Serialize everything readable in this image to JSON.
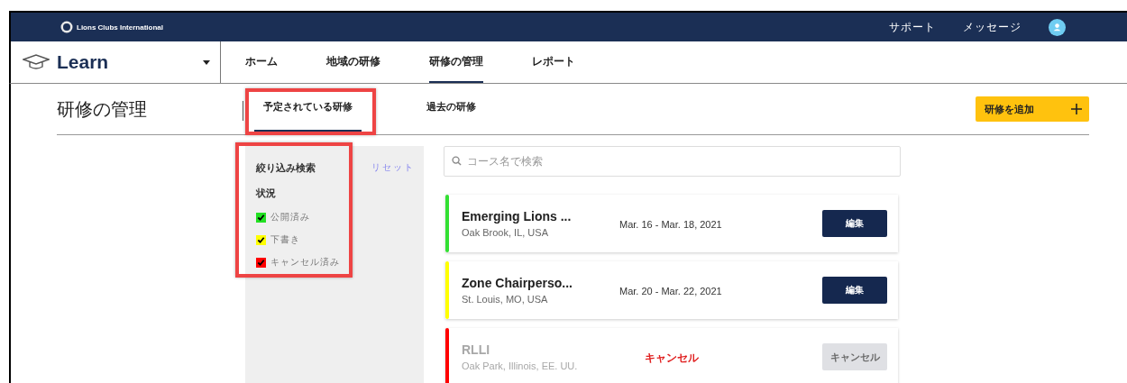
{
  "header": {
    "brand": "Lions Clubs International",
    "links": [
      "サポート",
      "メッセージ"
    ]
  },
  "app": {
    "name": "Learn"
  },
  "nav": [
    {
      "label": "ホーム",
      "selected": false
    },
    {
      "label": "地域の研修",
      "selected": false
    },
    {
      "label": "研修の管理",
      "selected": true
    },
    {
      "label": "レポート",
      "selected": false
    }
  ],
  "page": {
    "title": "研修の管理"
  },
  "tabs": [
    {
      "label": "予定されている研修",
      "selected": true,
      "highlighted": true
    },
    {
      "label": "過去の研修",
      "selected": false,
      "highlighted": false
    }
  ],
  "add_button": "研修を追加",
  "filter": {
    "title": "絞り込み検索",
    "reset": "リセット",
    "section": "状況",
    "highlighted": true,
    "options": [
      {
        "label": "公開済み",
        "checked": true,
        "color": "#22e022"
      },
      {
        "label": "下書き",
        "checked": true,
        "color": "#ffff00"
      },
      {
        "label": "キャンセル済み",
        "checked": true,
        "color": "#ff0000"
      }
    ]
  },
  "search": {
    "placeholder": "コース名で検索"
  },
  "courses": [
    {
      "title": "Emerging Lions ...",
      "location": "Oak Brook, IL, USA",
      "dates": "Mar. 16 - Mar. 18, 2021",
      "color": "#33e033",
      "cancelled": false,
      "button": "編集"
    },
    {
      "title": "Zone Chairperso...",
      "location": "St. Louis, MO, USA",
      "dates": "Mar. 20 - Mar. 22, 2021",
      "color": "#ffff00",
      "cancelled": false,
      "button": "編集"
    },
    {
      "title": "RLLI",
      "location": "Oak Park, Illinois, EE. UU.",
      "status": "キャンセル",
      "color": "#ff0000",
      "cancelled": true,
      "button": "キャンセル"
    }
  ]
}
